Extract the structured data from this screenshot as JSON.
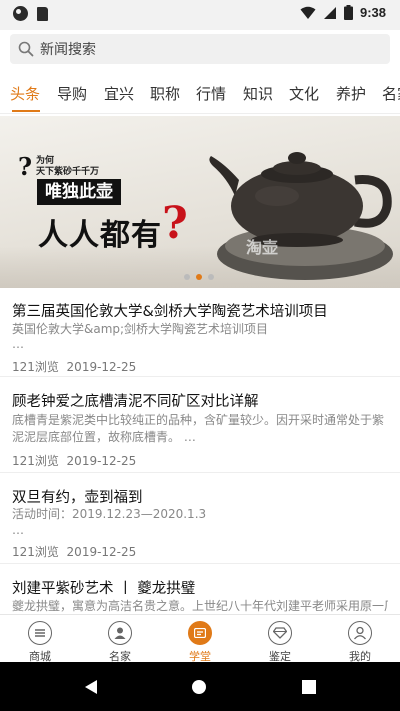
{
  "status_bar": {
    "time": "9:38"
  },
  "search": {
    "placeholder": "新闻搜索"
  },
  "tabs": [
    {
      "label": "头条",
      "active": true
    },
    {
      "label": "导购"
    },
    {
      "label": "宜兴"
    },
    {
      "label": "职称"
    },
    {
      "label": "行情"
    },
    {
      "label": "知识"
    },
    {
      "label": "文化"
    },
    {
      "label": "养护"
    },
    {
      "label": "名家"
    }
  ],
  "banner": {
    "question_mark": "?",
    "small_text_1": "为何",
    "small_text_2": "天下紫砂千千万",
    "headline_1": "唯独此壶",
    "headline_2": "人人都有",
    "headline_q": "?",
    "watermark": "淘壶",
    "dots": {
      "count": 3,
      "active_index": 1
    }
  },
  "articles": [
    {
      "title": "第三届英国伦敦大学&剑桥大学陶瓷艺术培训项目",
      "desc": "英国伦敦大学&amp;剑桥大学陶瓷艺术培训项目",
      "desc_tail": "…",
      "views": "121浏览",
      "date": "2019-12-25"
    },
    {
      "title": "顾老钟爱之底槽清泥不同矿区对比详解",
      "desc": "底槽青是紫泥类中比较纯正的品种，含矿量较少。因开采时通常处于紫泥泥层底部位置，故称底槽青。 …",
      "views": "121浏览",
      "date": "2019-12-25"
    },
    {
      "title": "双旦有约，壶到福到",
      "desc": "活动时间：2019.12.23—2020.1.3",
      "desc_tail": "…",
      "views": "121浏览",
      "date": "2019-12-25"
    },
    {
      "title": "刘建平紫砂艺术 丨 夔龙拱璧",
      "desc": "夔龙拱璧，寓意为高洁名贵之意。上世纪八十年代刘建平老师采用原一厂"
    }
  ],
  "bottom_nav": [
    {
      "label": "商城",
      "icon": "mall-icon"
    },
    {
      "label": "名家",
      "icon": "person-icon"
    },
    {
      "label": "学堂",
      "icon": "school-icon",
      "active": true
    },
    {
      "label": "鉴定",
      "icon": "diamond-icon"
    },
    {
      "label": "我的",
      "icon": "profile-icon"
    }
  ],
  "colors": {
    "accent": "#e07a18",
    "banner_red": "#c8121a"
  }
}
